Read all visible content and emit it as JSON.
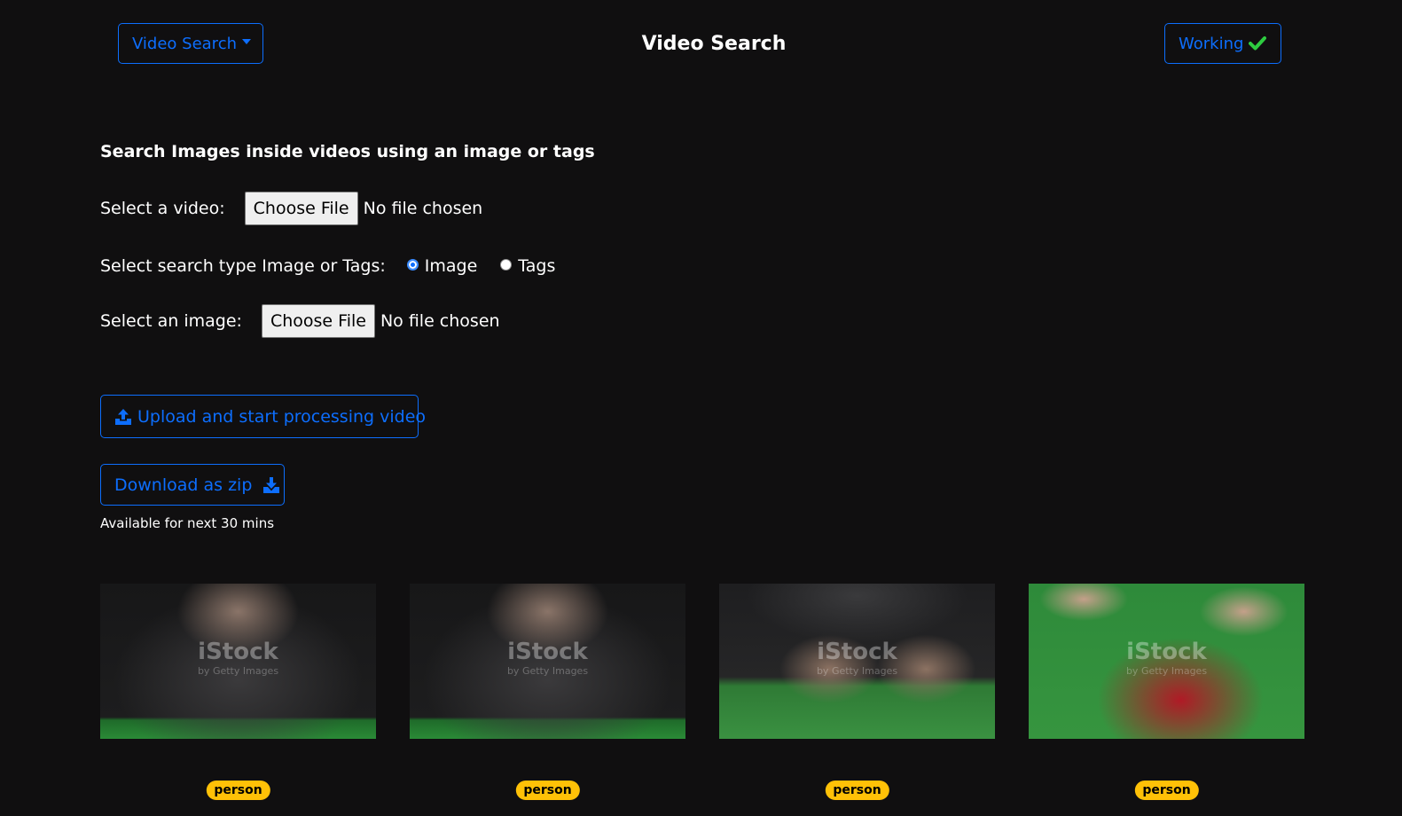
{
  "header": {
    "nav_label": "Video Search",
    "title": "Video Search",
    "status_label": "Working",
    "status_icon": "check-icon",
    "status_icon_color": "#2ecc40"
  },
  "form": {
    "heading": "Search Images inside videos using an image or tags",
    "video_label": "Select a video:",
    "video_button": "Choose File",
    "video_status": "No file chosen",
    "type_label": "Select search type Image or Tags:",
    "type_options": [
      {
        "label": "Image",
        "checked": true
      },
      {
        "label": "Tags",
        "checked": false
      }
    ],
    "image_label": "Select an image:",
    "image_button": "Choose File",
    "image_status": "No file chosen"
  },
  "actions": {
    "upload_label": "Upload and start processing video",
    "upload_icon": "upload-icon",
    "download_label": "Download as zip",
    "download_icon": "download-icon",
    "availability": "Available for next 30 mins"
  },
  "results": [
    {
      "watermark": "iStock",
      "watermark_sub": "by Getty Images",
      "tag": "person"
    },
    {
      "watermark": "iStock",
      "watermark_sub": "by Getty Images",
      "tag": "person"
    },
    {
      "watermark": "iStock",
      "watermark_sub": "by Getty Images",
      "tag": "person"
    },
    {
      "watermark": "iStock",
      "watermark_sub": "by Getty Images",
      "tag": "person"
    }
  ],
  "colors": {
    "background": "#100f10",
    "accent": "#0d6efd",
    "badge": "#ffc107"
  }
}
